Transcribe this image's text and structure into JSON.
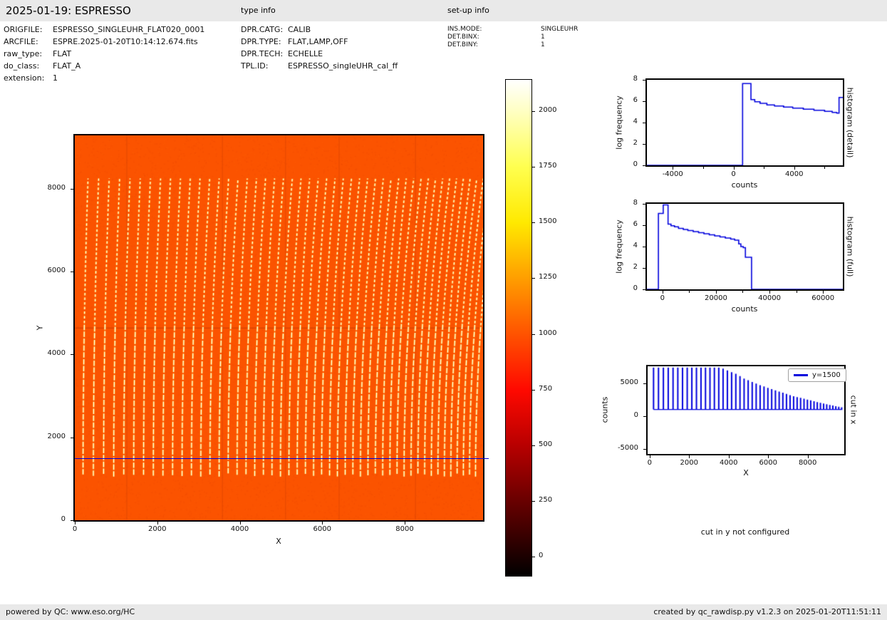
{
  "topbar": {
    "title": "2025-01-19: ESPRESSO",
    "type_info_label": "type info",
    "setup_info_label": "set-up info"
  },
  "file_info": {
    "rows": [
      {
        "label": "ORIGFILE:",
        "value": "ESPRESSO_SINGLEUHR_FLAT020_0001"
      },
      {
        "label": "ARCFILE:",
        "value": "ESPRE.2025-01-20T10:14:12.674.fits"
      },
      {
        "label": "raw_type:",
        "value": "FLAT"
      },
      {
        "label": "do_class:",
        "value": "FLAT_A"
      },
      {
        "label": "extension:",
        "value": "1"
      }
    ]
  },
  "type_info": {
    "rows": [
      {
        "label": "DPR.CATG:",
        "value": "CALIB"
      },
      {
        "label": "DPR.TYPE:",
        "value": "FLAT,LAMP,OFF"
      },
      {
        "label": "DPR.TECH:",
        "value": "ECHELLE"
      },
      {
        "label": "TPL.ID:",
        "value": "ESPRESSO_singleUHR_cal_ff"
      }
    ]
  },
  "setup_info": {
    "rows": [
      {
        "label": "INS.MODE:",
        "value": "SINGLEUHR"
      },
      {
        "label": "DET.BINX:",
        "value": "1"
      },
      {
        "label": "DET.BINY:",
        "value": "1"
      }
    ]
  },
  "cut_y_message": "cut in y not configured",
  "footer": {
    "left": "powered by QC: www.eso.org/HC",
    "right": "created by qc_rawdisp.py v1.2.3 on 2025-01-20T11:51:11"
  },
  "chart_data": [
    {
      "id": "raw_image",
      "type": "heatmap",
      "xlabel": "X",
      "ylabel": "Y",
      "xlim": [
        0,
        9900
      ],
      "ylim": [
        0,
        9290
      ],
      "x_ticks": [
        0,
        2000,
        4000,
        6000,
        8000
      ],
      "y_ticks": [
        0,
        2000,
        4000,
        6000,
        8000
      ],
      "background_counts": 1000,
      "background_color": "#fb5300",
      "colormap": "hot",
      "order_stripes": {
        "x_positions": [
          200,
          450,
          698,
          943,
          1187,
          1428,
          1667,
          1904,
          2138,
          2371,
          2601,
          2829,
          3055,
          3278,
          3500,
          3719,
          3936,
          4151,
          4363,
          4574,
          4782,
          4988,
          5192,
          5393,
          5593,
          5790,
          5985,
          6178,
          6368,
          6557,
          6743,
          6927,
          7109,
          7288,
          7466,
          7641,
          7814,
          7985,
          8153,
          8320,
          8484,
          8646,
          8806,
          8963,
          9119,
          9272,
          9423,
          9572,
          9718
        ],
        "y_range": [
          1050,
          8250
        ],
        "tilt_range": [
          120,
          500
        ],
        "dash_boundary_y": 4650,
        "core_color": "#ffffff",
        "halo_color": "rgba(255,190,30,0.85)"
      },
      "cut_line": {
        "y": 1500,
        "color": "#0000dd"
      },
      "horizontal_feature_y": 4650,
      "amp_seams_x": [
        1250,
        3570,
        5100,
        6400,
        8250
      ]
    },
    {
      "id": "colorbar",
      "type": "colorbar",
      "ticks": [
        0,
        250,
        500,
        750,
        1000,
        1250,
        1500,
        1750,
        2000
      ],
      "vmin": -85,
      "vmax": 2140,
      "gradient_stops": [
        [
          0,
          "#000000"
        ],
        [
          0.038,
          "#1b0000"
        ],
        [
          0.151,
          "#690000"
        ],
        [
          0.263,
          "#b80000"
        ],
        [
          0.375,
          "#ff0900"
        ],
        [
          0.488,
          "#ff5300"
        ],
        [
          0.6,
          "#ff9e00"
        ],
        [
          0.712,
          "#ffe900"
        ],
        [
          0.825,
          "#ffff50"
        ],
        [
          0.937,
          "#ffffc3"
        ],
        [
          1,
          "#ffffff"
        ]
      ]
    },
    {
      "id": "hist_detail",
      "type": "line",
      "side_label": "histogram (detail)",
      "xlabel": "counts",
      "ylabel": "log frequency",
      "xlim": [
        -5700,
        7200
      ],
      "ylim": [
        0,
        8
      ],
      "x_ticks": [
        -4000,
        0,
        4000
      ],
      "x_minor_ticks": [
        -2000,
        2000,
        6000
      ],
      "y_ticks": [
        0,
        2,
        4,
        6,
        8
      ],
      "line_color": "#0000dd",
      "steps": [
        [
          -5700,
          0
        ],
        [
          600,
          0
        ],
        [
          600,
          7.65
        ],
        [
          1150,
          7.65
        ],
        [
          1150,
          6.15
        ],
        [
          1400,
          6.15
        ],
        [
          1400,
          5.95
        ],
        [
          1750,
          5.95
        ],
        [
          1750,
          5.8
        ],
        [
          2200,
          5.8
        ],
        [
          2200,
          5.65
        ],
        [
          2700,
          5.65
        ],
        [
          2700,
          5.55
        ],
        [
          3300,
          5.55
        ],
        [
          3300,
          5.45
        ],
        [
          3900,
          5.45
        ],
        [
          3900,
          5.35
        ],
        [
          4600,
          5.35
        ],
        [
          4600,
          5.25
        ],
        [
          5300,
          5.25
        ],
        [
          5300,
          5.15
        ],
        [
          6000,
          5.15
        ],
        [
          6000,
          5.05
        ],
        [
          6500,
          5.05
        ],
        [
          6500,
          4.95
        ],
        [
          6800,
          4.95
        ],
        [
          6800,
          4.88
        ],
        [
          6950,
          4.88
        ],
        [
          6950,
          6.35
        ],
        [
          7200,
          6.35
        ]
      ]
    },
    {
      "id": "hist_full",
      "type": "line",
      "side_label": "histogram (full)",
      "xlabel": "counts",
      "ylabel": "log frequency",
      "xlim": [
        -5800,
        67400
      ],
      "ylim": [
        0,
        8
      ],
      "x_ticks": [
        0,
        20000,
        40000,
        60000
      ],
      "x_minor_ticks": [
        10000,
        30000,
        50000
      ],
      "y_ticks": [
        0,
        2,
        4,
        6,
        8
      ],
      "line_color": "#0000dd",
      "steps": [
        [
          -5800,
          0
        ],
        [
          -1500,
          0
        ],
        [
          -1500,
          7.1
        ],
        [
          300,
          7.1
        ],
        [
          300,
          7.9
        ],
        [
          2100,
          7.9
        ],
        [
          2100,
          6.1
        ],
        [
          3200,
          6.1
        ],
        [
          3200,
          5.95
        ],
        [
          4500,
          5.95
        ],
        [
          4500,
          5.85
        ],
        [
          6000,
          5.85
        ],
        [
          6000,
          5.7
        ],
        [
          7800,
          5.7
        ],
        [
          7800,
          5.6
        ],
        [
          9500,
          5.6
        ],
        [
          9500,
          5.5
        ],
        [
          11500,
          5.5
        ],
        [
          11500,
          5.4
        ],
        [
          13500,
          5.4
        ],
        [
          13500,
          5.3
        ],
        [
          15500,
          5.3
        ],
        [
          15500,
          5.2
        ],
        [
          17500,
          5.2
        ],
        [
          17500,
          5.1
        ],
        [
          19500,
          5.1
        ],
        [
          19500,
          5.0
        ],
        [
          21500,
          5.0
        ],
        [
          21500,
          4.9
        ],
        [
          23500,
          4.9
        ],
        [
          23500,
          4.8
        ],
        [
          25500,
          4.8
        ],
        [
          25500,
          4.7
        ],
        [
          27000,
          4.7
        ],
        [
          27000,
          4.6
        ],
        [
          28500,
          4.6
        ],
        [
          28500,
          4.25
        ],
        [
          29300,
          4.25
        ],
        [
          29300,
          4.0
        ],
        [
          30200,
          4.0
        ],
        [
          30200,
          3.9
        ],
        [
          31000,
          3.9
        ],
        [
          31000,
          3.0
        ],
        [
          33300,
          3.0
        ],
        [
          33300,
          0
        ],
        [
          67400,
          0
        ]
      ]
    },
    {
      "id": "cut_x",
      "type": "spikes",
      "side_label": "cut in x",
      "legend_label": "y=1500",
      "xlabel": "X",
      "ylabel": "counts",
      "xlim": [
        -100,
        9850
      ],
      "ylim": [
        -5800,
        7600
      ],
      "x_ticks": [
        0,
        2000,
        4000,
        6000,
        8000
      ],
      "y_ticks": [
        -5000,
        0,
        5000
      ],
      "baseline": 1000,
      "x_start": 200,
      "x_end": 9750,
      "spike_positions": [
        200,
        450,
        698,
        943,
        1187,
        1428,
        1667,
        1904,
        2138,
        2371,
        2601,
        2829,
        3055,
        3278,
        3500,
        3719,
        3936,
        4151,
        4363,
        4574,
        4782,
        4988,
        5192,
        5393,
        5593,
        5790,
        5985,
        6178,
        6368,
        6557,
        6743,
        6927,
        7109,
        7288,
        7466,
        7641,
        7814,
        7985,
        8153,
        8320,
        8484,
        8646,
        8806,
        8963,
        9119,
        9272,
        9423,
        9572,
        9718
      ],
      "height_envelope": [
        [
          0,
          7400
        ],
        [
          3600,
          7400
        ],
        [
          4000,
          6900
        ],
        [
          4400,
          6400
        ],
        [
          4800,
          5700
        ],
        [
          5200,
          5200
        ],
        [
          5600,
          4700
        ],
        [
          6000,
          4300
        ],
        [
          6400,
          3900
        ],
        [
          6800,
          3500
        ],
        [
          7200,
          3100
        ],
        [
          7600,
          2800
        ],
        [
          8000,
          2500
        ],
        [
          8400,
          2200
        ],
        [
          8800,
          1900
        ],
        [
          9200,
          1650
        ],
        [
          9600,
          1400
        ],
        [
          9900,
          1250
        ]
      ],
      "line_color": "#0000dd"
    }
  ]
}
